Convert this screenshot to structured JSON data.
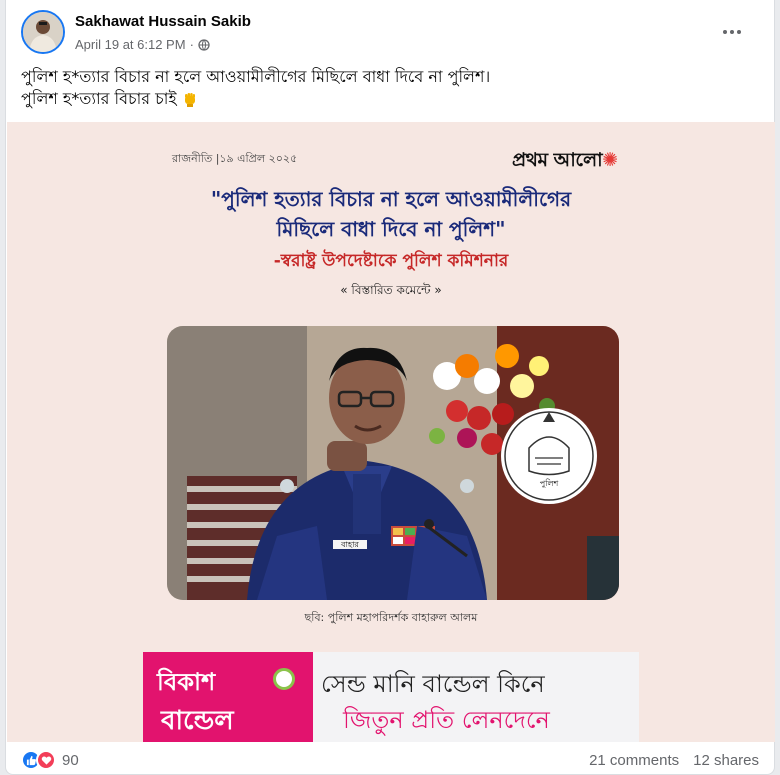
{
  "post": {
    "author": "Sakhawat Hussain Sakib",
    "timestamp": "April 19 at 6:12 PM",
    "separator": "·",
    "privacy_icon": "globe-icon",
    "text_line1": "পুলিশ হ*ত্যার বিচার না হলে আওয়ামীলীগের মিছিলে বাধা দিবে না পুলিশ।",
    "text_line2": "পুলিশ হ*ত্যার বিচার চাই"
  },
  "image": {
    "dateline": "রাজনীতি |১৯ এপ্রিল ২০২৫",
    "brand": "প্রথম আলো",
    "headline_line1": "\"পুলিশ হত্যার বিচার না হলে আওয়ামীলীগের",
    "headline_line2": "মিছিলে বাধা দিবে না পুলিশ\"",
    "subline": "-স্বরাষ্ট্র উপদেষ্টাকে পুলিশ কমিশনার",
    "cta": "« বিস্তারিত কমেন্টে »",
    "caption": "ছবি: পুলিশ মহাপরিদর্শক বাহারুল আলম",
    "badge_text": "পুলিশ",
    "nameplate": "বাহার",
    "ad": {
      "brand_line1": "বিকাশ",
      "brand_line2": "বান্ডেল",
      "line1": "সেন্ড মানি বান্ডেল কিনে",
      "line2": "জিতুন প্রতি লেনদেনে"
    }
  },
  "footer": {
    "reaction_count": "90",
    "comments": "21 comments",
    "shares": "12 shares"
  },
  "colors": {
    "facebook_blue": "#1877f2",
    "love_red": "#f33e58",
    "headline_blue": "#1a2a7a",
    "subline_red": "#c62828",
    "bkash_pink": "#e2136e",
    "image_bg": "#f6e7e2"
  }
}
